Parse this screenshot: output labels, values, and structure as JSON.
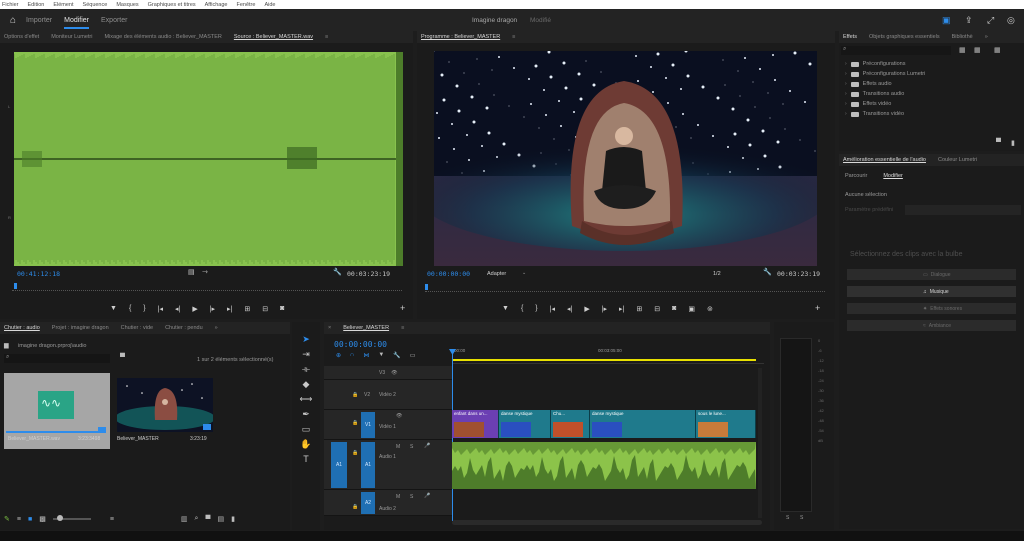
{
  "menu": [
    "Fichier",
    "Edition",
    "Elément",
    "Séquence",
    "Masques",
    "Graphiques et titres",
    "Affichage",
    "Fenêtre",
    "Aide"
  ],
  "header": {
    "workspaces": [
      "Importer",
      "Modifier",
      "Exporter"
    ],
    "project_title": "Imagine dragon",
    "project_status": "Modifié"
  },
  "source_panel": {
    "tabs": [
      "Options d'effet",
      "Moniteur Lumetri",
      "Mixage des éléments audio : Believer_MASTER",
      "Source : Believer_MASTER.wav"
    ],
    "timecode_in": "00:41:12:18",
    "timecode_out": "00:03:23:19",
    "db_labels": [
      "L",
      "R"
    ]
  },
  "program_panel": {
    "title": "Programme : Believer_MASTER",
    "timecode_in": "00:00:00:00",
    "fit_label": "Adapter",
    "zoom": "1/2",
    "timecode_out": "00:03:23:19"
  },
  "effects_panel": {
    "tabs": [
      "Effets",
      "Objets graphiques essentiels",
      "Bibliothè"
    ],
    "items": [
      "Préconfigurations",
      "Préconfigurations Lumetri",
      "Effets audio",
      "Transitions audio",
      "Effets vidéo",
      "Transitions vidéo"
    ]
  },
  "essential_audio": {
    "tabs": [
      "Amélioration essentielle de l'audio",
      "Couleur Lumetri"
    ],
    "sub_tabs": [
      "Parcourir",
      "Modifier"
    ],
    "preset_label": "Aucune sélection",
    "preset_field": "Paramètre prédéfini",
    "hint": "Sélectionnez des clips avec la bulbe",
    "buttons": [
      "Dialogue",
      "Musique",
      "Effets sonores",
      "Ambiance"
    ]
  },
  "project_panel": {
    "tabs": [
      "Chutier : audio",
      "Projet : imagine dragon",
      "Chutier : vide",
      "Chutier : pendu"
    ],
    "path": "imagine dragon.prproj\\audio",
    "count": "1 sur 2 éléments sélectionné(s)",
    "items": [
      {
        "name": "Believer_MASTER.wav",
        "duration": "3:23:3498"
      },
      {
        "name": "Believer_MASTER",
        "duration": "3:23:19"
      }
    ]
  },
  "timeline": {
    "tab": "Believer_MASTER",
    "timecode": "00:00:00:00",
    "ruler": [
      "00:00",
      "00:03:05:00"
    ],
    "tracks_video": [
      "V3",
      "V2",
      "V1"
    ],
    "track_names": {
      "v2": "Vidéo 2",
      "v1": "Vidéo 1",
      "a1": "Audio 1",
      "a2": "Audio 2"
    },
    "tracks_audio": [
      "A1",
      "A2",
      "A3"
    ],
    "clip_labels": [
      "enfant dans un...",
      "danse mystique",
      "Chu...",
      "danse mystique",
      "sous le lune..."
    ],
    "patch_v": "V1",
    "patch_a": "A1"
  },
  "meter": {
    "ticks": [
      "0",
      "-6",
      "-12",
      "-18",
      "-24",
      "-30",
      "-36",
      "-42",
      "-48",
      "-54",
      "dB"
    ],
    "solo": [
      "S",
      "S"
    ]
  },
  "colors": {
    "accent": "#2d8ceb",
    "audio_clip": "#8cc34a",
    "video_clip": "#1f7a8c",
    "waveform": "#7fbc46"
  }
}
